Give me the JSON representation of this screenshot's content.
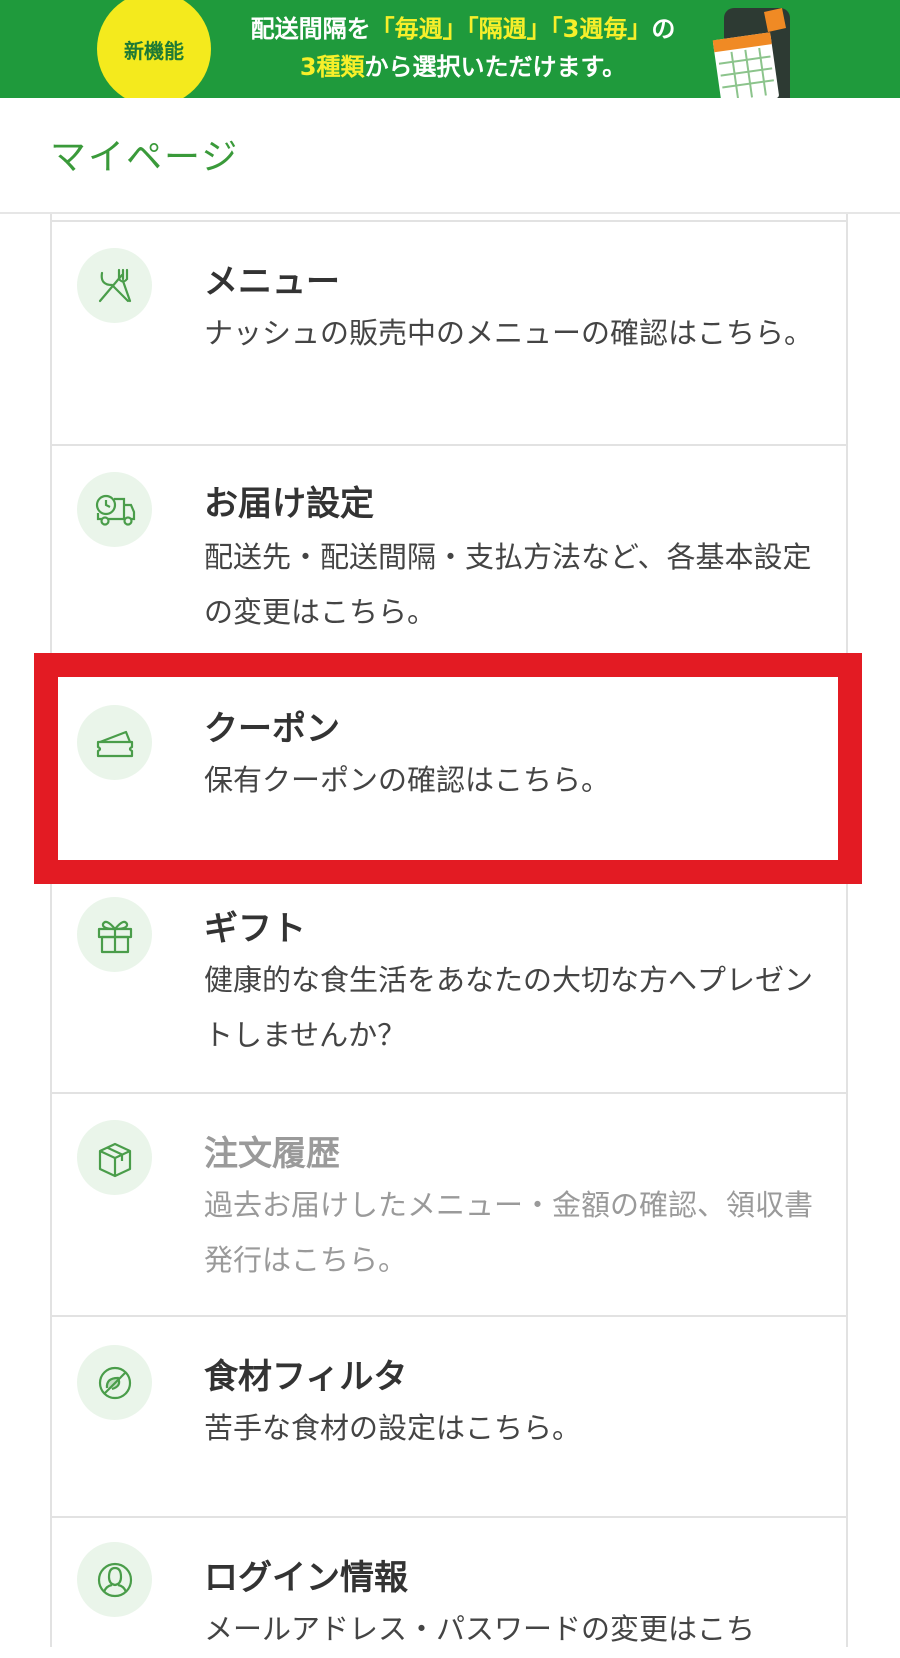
{
  "banner": {
    "badge": "新機能",
    "line1_prefix": "配送間隔を",
    "line1_q1": "「毎週」",
    "line1_q2": "「隔週」",
    "line1_q3": "「3週毎」",
    "line1_suffix": "の",
    "line2_hl": "3種類",
    "line2_rest": "から選択いただけます。"
  },
  "header": {
    "title": "マイページ"
  },
  "menu": {
    "items": [
      {
        "title": "メニュー",
        "desc": "ナッシュの販売中のメニューの確認はこちら。",
        "icon": "fork-knife-icon"
      },
      {
        "title": "お届け設定",
        "desc": "配送先・配送間隔・支払方法など、各基本設定の変更はこちら。",
        "icon": "delivery-truck-icon"
      },
      {
        "title": "クーポン",
        "desc": "保有クーポンの確認はこちら。",
        "icon": "coupon-icon"
      },
      {
        "title": "ギフト",
        "desc": "健康的な食生活をあなたの大切な方へプレゼントしませんか？",
        "icon": "gift-icon"
      },
      {
        "title": "注文履歴",
        "desc": "過去お届けしたメニュー・金額の確認、領収書発行はこちら。",
        "icon": "box-icon"
      },
      {
        "title": "食材フィルタ",
        "desc": "苦手な食材の設定はこちら。",
        "icon": "ingredient-filter-icon"
      },
      {
        "title": "ログイン情報",
        "desc": "メールアドレス・パスワードの変更はこち",
        "icon": "user-icon"
      }
    ]
  },
  "colors": {
    "brand_green": "#1f9a3c",
    "title_green": "#3a9a3a",
    "highlight_red": "#e31b23",
    "badge_yellow": "#f4ea1d"
  }
}
